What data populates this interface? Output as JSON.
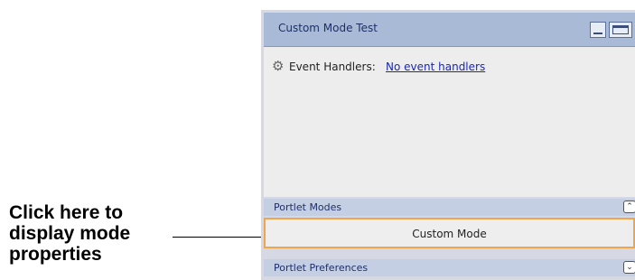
{
  "callout": {
    "lines": [
      "Click here to",
      "display mode",
      "properties"
    ]
  },
  "portlet": {
    "title": "Custom Mode Test",
    "event_label": "Event Handlers:",
    "event_link": "No event handlers",
    "sections": {
      "modes_label": "Portlet Modes",
      "mode_item": "Custom Mode",
      "prefs_label": "Portlet Preferences"
    },
    "icons": {
      "event": "gear-icon",
      "minimize": "minimize-icon",
      "maximize": "maximize-icon",
      "collapse": "chevron-up-icon",
      "expand": "chevron-down-icon"
    }
  }
}
